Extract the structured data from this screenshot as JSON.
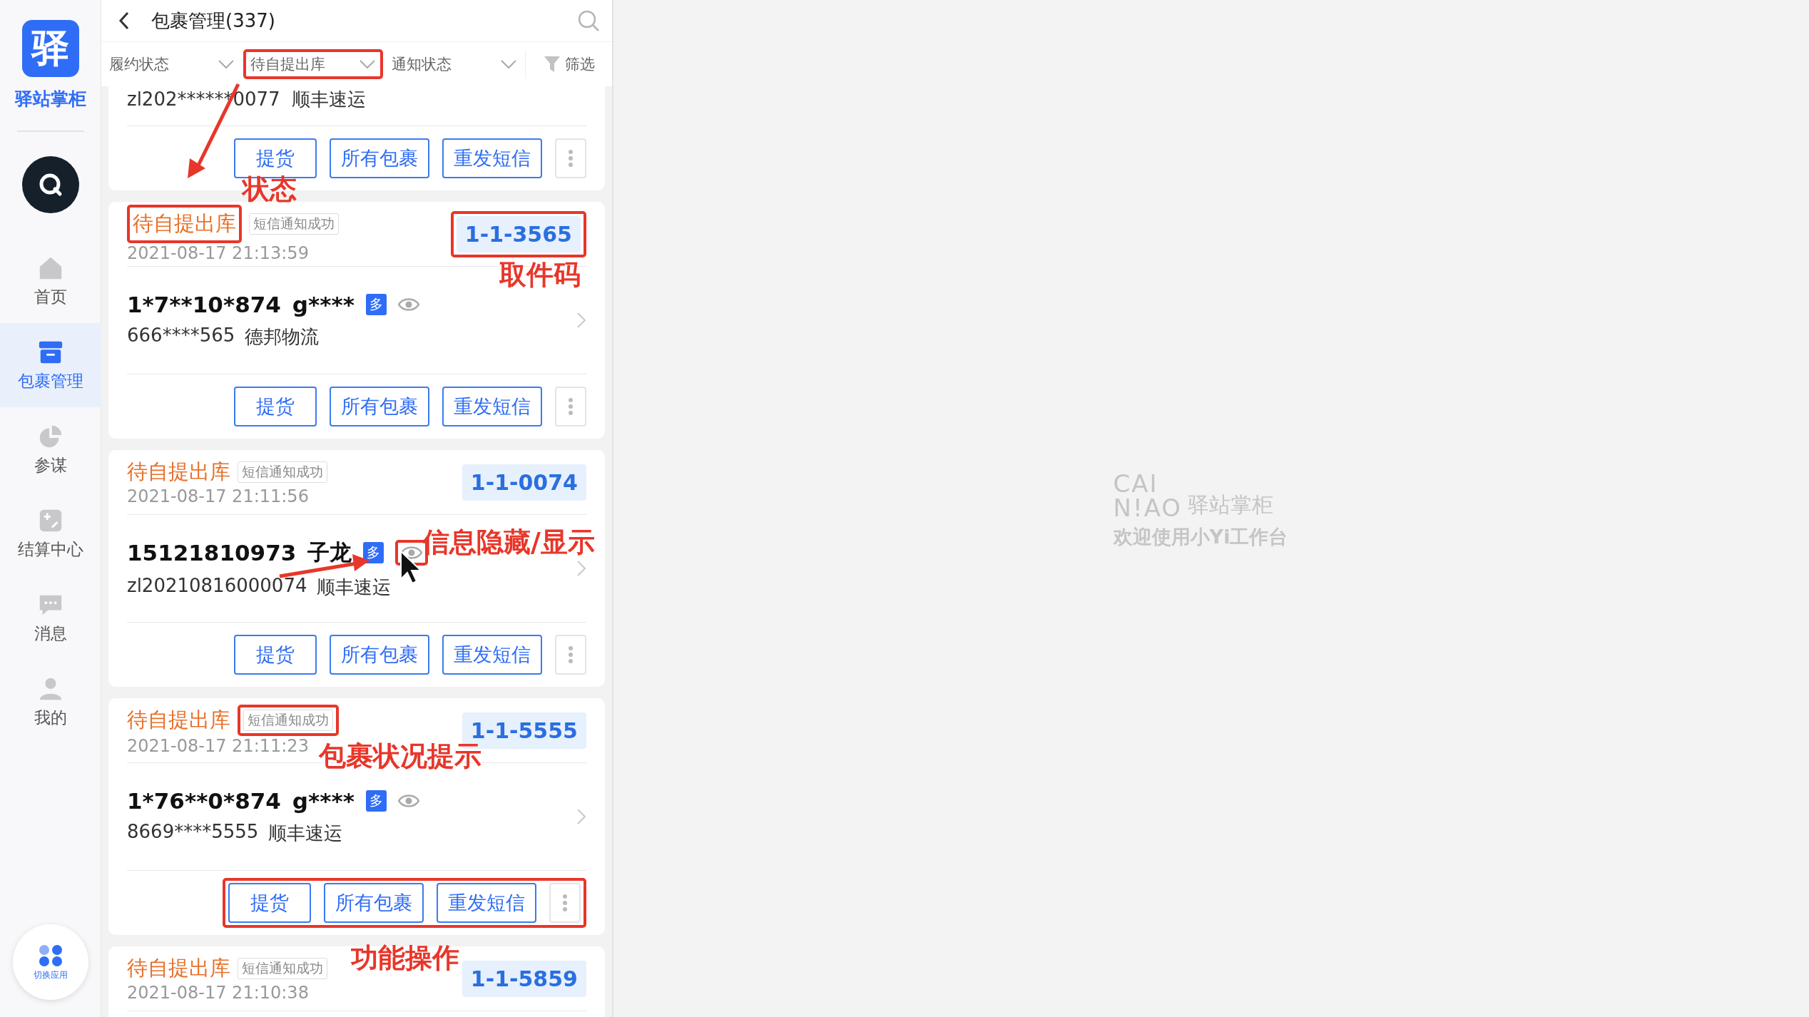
{
  "sidebar": {
    "logo_glyph": "驿",
    "app_name": "驿站掌柜",
    "items": [
      {
        "label": "首页",
        "selected": false
      },
      {
        "label": "包裹管理",
        "selected": true
      },
      {
        "label": "参谋",
        "selected": false
      },
      {
        "label": "结算中心",
        "selected": false
      },
      {
        "label": "消息",
        "selected": false
      },
      {
        "label": "我的",
        "selected": false
      }
    ],
    "switch_app": "切换应用"
  },
  "header": {
    "title": "包裹管理(337)"
  },
  "filters": [
    {
      "label": "履约状态",
      "highlighted": false
    },
    {
      "label": "待自提出库",
      "highlighted": true
    },
    {
      "label": "通知状态",
      "highlighted": false
    }
  ],
  "filter_button": "筛选",
  "cards": [
    {
      "kind": "tail",
      "tracking": "zl202******0077",
      "carrier": "顺丰速运",
      "actions": [
        "提货",
        "所有包裹",
        "重发短信"
      ],
      "actions_highlighted": false
    },
    {
      "kind": "full",
      "status": "待自提出库",
      "status_highlighted": true,
      "tag": "短信通知成功",
      "tag_highlighted": false,
      "time": "2021-08-17 21:13:59",
      "code": "1-1-3565",
      "code_highlighted": true,
      "phone": "1*7**10*874",
      "name": "g****",
      "badge": "多",
      "eye_highlighted": false,
      "tracking": "666****565",
      "carrier": "德邦物流",
      "actions": [
        "提货",
        "所有包裹",
        "重发短信"
      ],
      "actions_highlighted": false
    },
    {
      "kind": "full",
      "status": "待自提出库",
      "status_highlighted": false,
      "tag": "短信通知成功",
      "tag_highlighted": false,
      "time": "2021-08-17 21:11:56",
      "code": "1-1-0074",
      "code_highlighted": false,
      "phone": "15121810973",
      "name": "子龙",
      "badge": "多",
      "eye_highlighted": true,
      "tracking": "zl20210816000074",
      "carrier": "顺丰速运",
      "actions": [
        "提货",
        "所有包裹",
        "重发短信"
      ],
      "actions_highlighted": false
    },
    {
      "kind": "full",
      "status": "待自提出库",
      "status_highlighted": false,
      "tag": "短信通知成功",
      "tag_highlighted": true,
      "time": "2021-08-17 21:11:23",
      "code": "1-1-5555",
      "code_highlighted": false,
      "phone": "1*76**0*874",
      "name": "g****",
      "badge": "多",
      "eye_highlighted": false,
      "tracking": "8669****5555",
      "carrier": "顺丰速运",
      "actions": [
        "提货",
        "所有包裹",
        "重发短信"
      ],
      "actions_highlighted": true
    },
    {
      "kind": "head",
      "status": "待自提出库",
      "status_highlighted": false,
      "tag": "短信通知成功",
      "tag_highlighted": false,
      "time": "2021-08-17 21:10:38",
      "code": "1-1-5859",
      "code_highlighted": false
    }
  ],
  "annotations": [
    {
      "text": "状态"
    },
    {
      "text": "取件码"
    },
    {
      "text": "信息隐藏/显示"
    },
    {
      "text": "包裹状况提示"
    },
    {
      "text": "功能操作"
    }
  ],
  "welcome": {
    "logo_top": "CAI",
    "logo_bottom": "N!AO",
    "brand": "驿站掌柜",
    "message": "欢迎使用小Yi工作台"
  }
}
